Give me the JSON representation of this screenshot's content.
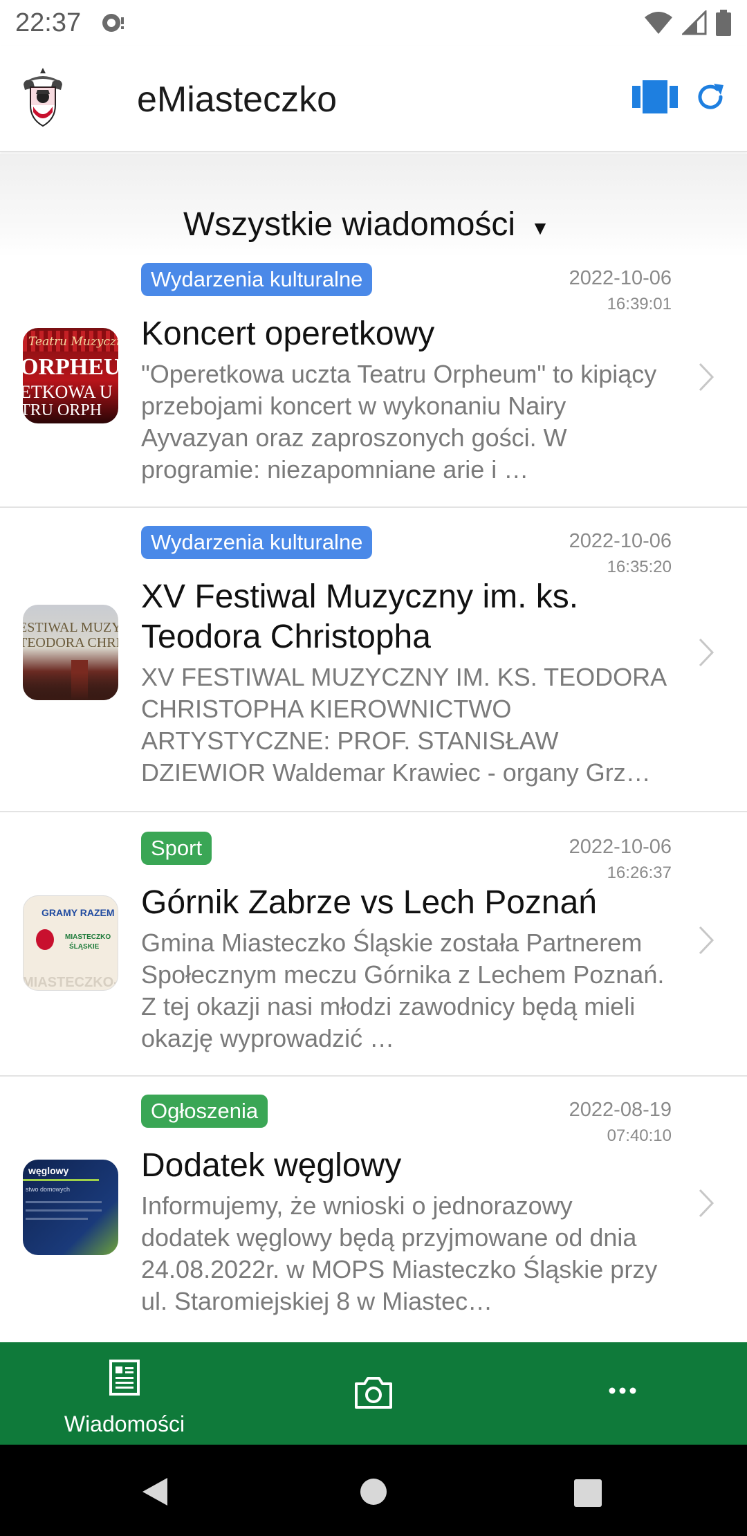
{
  "status": {
    "time": "22:37"
  },
  "app": {
    "title": "eMiasteczko"
  },
  "filter": {
    "label": "Wszystkie wiadomości"
  },
  "news": [
    {
      "category": "Wydarzenia kulturalne",
      "category_color": "#4a89e8",
      "date": "2022-10-06",
      "time": "16:39:01",
      "title": "Koncert operetkowy",
      "excerpt": "\"Operetkowa uczta Teatru Orpheum\" to kipiący przebojami koncert w wykonaniu Nairy Ayvazyan oraz zaproszonych gości. W programie: niezapomniane arie i …",
      "thumb_text": [
        "Teatru Muzyczn",
        "ORPHEU",
        "ETKOWA U",
        "TRU ORPH"
      ]
    },
    {
      "category": "Wydarzenia kulturalne",
      "category_color": "#4a89e8",
      "date": "2022-10-06",
      "time": "16:35:20",
      "title": "XV Festiwal Muzyczny im. ks. Teodora Christopha",
      "excerpt": "XV FESTIWAL MUZYCZNY IM. KS. TEODORA CHRISTOPHA KIEROWNICTWO ARTYSTYCZNE: PROF. STANISŁAW DZIEWIOR Waldemar Krawiec - organy Grz…",
      "thumb_text": [
        "ESTIWAL MUZY",
        "TEODORA CHRIS"
      ]
    },
    {
      "category": "Sport",
      "category_color": "#3aa655",
      "date": "2022-10-06",
      "time": "16:26:37",
      "title": "Górnik Zabrze vs Lech Poznań",
      "excerpt": "Gmina Miasteczko Śląskie została Partnerem Społecznym meczu Górnika z Lechem Poznań. Z tej okazji nasi młodzi zawodnicy będą mieli okazję wyprowadzić …",
      "thumb_text": [
        "GRAMY RAZEM",
        "MIASTECZKO",
        "ŚLĄSKIE",
        "MIASTECZKO-ŚL"
      ]
    },
    {
      "category": "Ogłoszenia",
      "category_color": "#3aa655",
      "date": "2022-08-19",
      "time": "07:40:10",
      "title": "Dodatek węglowy",
      "excerpt": "Informujemy, że wnioski o jednorazowy dodatek węglowy będą przyjmowane od dnia 24.08.2022r. w MOPS Miasteczko Śląskie przy ul. Staromiejskiej 8 w Miastec…",
      "thumb_text": [
        "węglowy",
        "stwo domowych"
      ]
    }
  ],
  "bottom_nav": {
    "news_label": "Wiadomości"
  }
}
